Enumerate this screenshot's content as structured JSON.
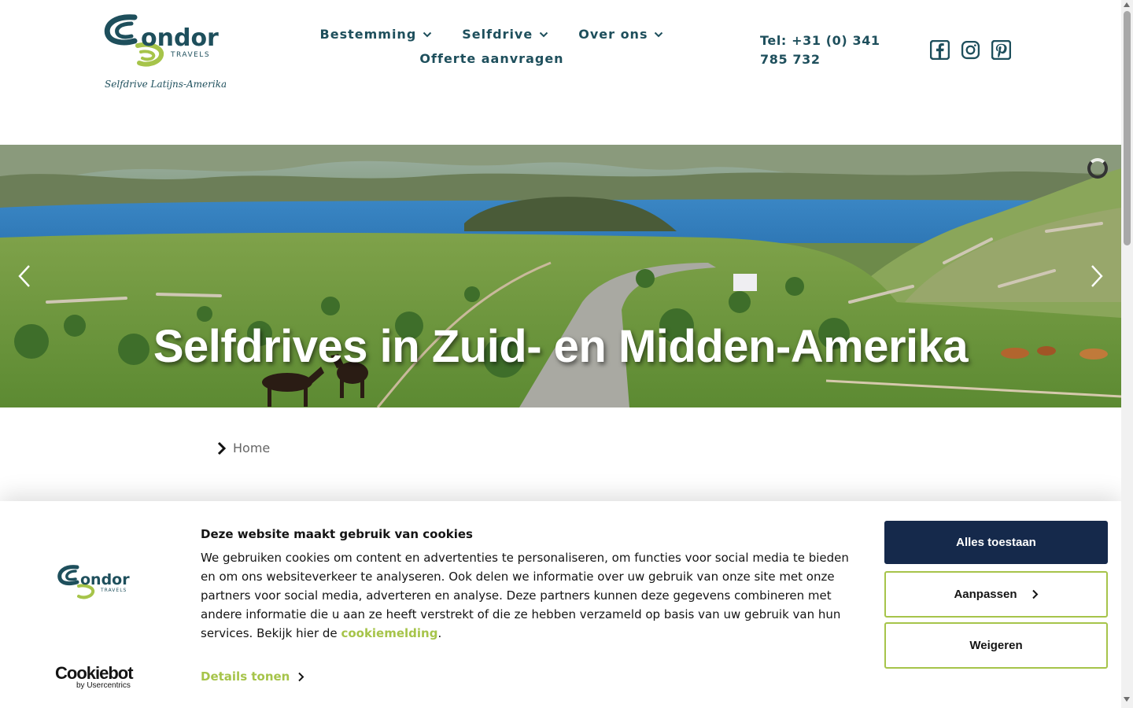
{
  "brand": {
    "logo_alt": "Condor Travels",
    "logo_word": "ondor",
    "logo_sub": "TRAVELS",
    "tagline": "Selfdrive Latijns-Amerika",
    "colors": {
      "teal": "#1e4f5c",
      "green": "#a6c44a",
      "navy": "#15294b"
    }
  },
  "nav": {
    "items": [
      {
        "label": "Bestemming",
        "icon": "chevron-down-icon"
      },
      {
        "label": "Selfdrive",
        "icon": "chevron-down-icon"
      },
      {
        "label": "Over ons",
        "icon": "chevron-down-icon"
      }
    ],
    "quote_label": "Offerte aanvragen"
  },
  "contact": {
    "phone_line1": "Tel: +31 (0) 341",
    "phone_line2": "785 732"
  },
  "social": [
    "facebook-icon",
    "instagram-icon",
    "pinterest-icon"
  ],
  "hero": {
    "title": "Selfdrives in Zuid- en Midden-Amerika",
    "prev_icon": "chevron-left-icon",
    "next_icon": "chevron-right-icon"
  },
  "breadcrumb": {
    "home_label": "Home"
  },
  "cookie_banner": {
    "title": "Deze website maakt gebruik van cookies",
    "text": "We gebruiken cookies om content en advertenties te personaliseren, om functies voor social media te bieden en om ons websiteverkeer te analyseren. Ook delen we informatie over uw gebruik van onze site met onze partners voor social media, adverteren en analyse. Deze partners kunnen deze gegevens combineren met andere informatie die u aan ze heeft verstrekt of die ze hebben verzameld op basis van uw gebruik van hun services. Bekijk hier de ",
    "link_label": "cookiemelding",
    "text_end": ".",
    "details_label": "Details tonen",
    "allow_label": "Alles toestaan",
    "customize_label": "Aanpassen",
    "decline_label": "Weigeren",
    "provider_name": "Cookiebot",
    "provider_sub": "by Usercentrics"
  }
}
